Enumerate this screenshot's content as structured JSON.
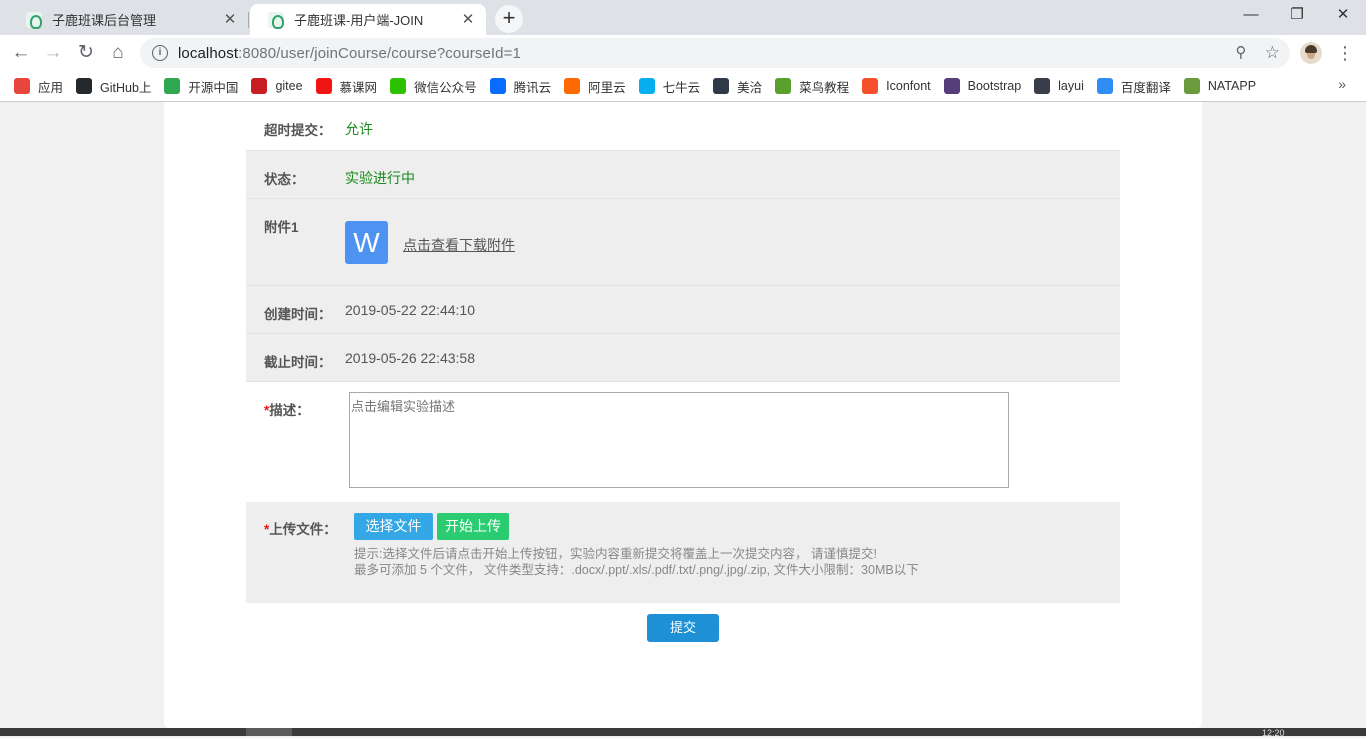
{
  "browser": {
    "tabs": [
      {
        "title": "子鹿班课后台管理",
        "active": false
      },
      {
        "title": "子鹿班课-用户端-JOIN",
        "active": true
      }
    ],
    "url": {
      "host": "localhost",
      "path": ":8080/user/joinCourse/course?courseId=1"
    },
    "bookmarks": [
      {
        "label": "应用",
        "icon": "apps-grid-icon",
        "color": "#e8453c"
      },
      {
        "label": "GitHub上",
        "icon": "github-icon",
        "color": "#24292e"
      },
      {
        "label": "开源中国",
        "icon": "oschina-icon",
        "color": "#2fa84f"
      },
      {
        "label": "gitee",
        "icon": "gitee-icon",
        "color": "#c71d23"
      },
      {
        "label": "慕课网",
        "icon": "imooc-flame-icon",
        "color": "#f01414"
      },
      {
        "label": "微信公众号",
        "icon": "wechat-icon",
        "color": "#2dc100"
      },
      {
        "label": "腾讯云",
        "icon": "tencent-cloud-icon",
        "color": "#0a6cff"
      },
      {
        "label": "阿里云",
        "icon": "aliyun-icon",
        "color": "#ff6a00"
      },
      {
        "label": "七牛云",
        "icon": "qiniu-icon",
        "color": "#06aeef"
      },
      {
        "label": "美洽",
        "icon": "meiqia-icon",
        "color": "#2f3a48"
      },
      {
        "label": "菜鸟教程",
        "icon": "runoob-icon",
        "color": "#5aa02c"
      },
      {
        "label": "Iconfont",
        "icon": "iconfont-icon",
        "color": "#f4502c"
      },
      {
        "label": "Bootstrap",
        "icon": "bootstrap-icon",
        "color": "#563d7c"
      },
      {
        "label": "layui",
        "icon": "layui-icon",
        "color": "#393d49"
      },
      {
        "label": "百度翻译",
        "icon": "baidu-translate-icon",
        "color": "#2e8ef6"
      },
      {
        "label": "NATAPP",
        "icon": "natapp-icon",
        "color": "#6a9a3c"
      }
    ],
    "more_label": "»"
  },
  "course": {
    "overtime_label": "超时提交：",
    "overtime_value": "允许",
    "status_label": "状态：",
    "status_value": "实验进行中",
    "attachment_label": "附件1",
    "attachment_icon_letter": "W",
    "attachment_link": "点击查看下载附件",
    "created_label": "创建时间：",
    "created_value": "2019-05-22 22:44:10",
    "deadline_label": "截止时间：",
    "deadline_value": "2019-05-26 22:43:58",
    "desc_required": "*",
    "desc_label": "描述：",
    "desc_placeholder": "点击编辑实验描述",
    "upload_required": "*",
    "upload_label": "上传文件：",
    "choose_button": "选择文件",
    "start_upload_button": "开始上传",
    "hint_line1": "提示:选择文件后请点击开始上传按钮，实验内容重新提交将覆盖上一次提交内容， 请谨慎提交!",
    "hint_line2": "最多可添加 5 个文件， 文件类型支持：.docx/.ppt/.xls/.pdf/.txt/.png/.jpg/.zip, 文件大小限制：30MB以下",
    "submit_button": "提交"
  },
  "taskbar": {
    "clock": "12:20"
  }
}
